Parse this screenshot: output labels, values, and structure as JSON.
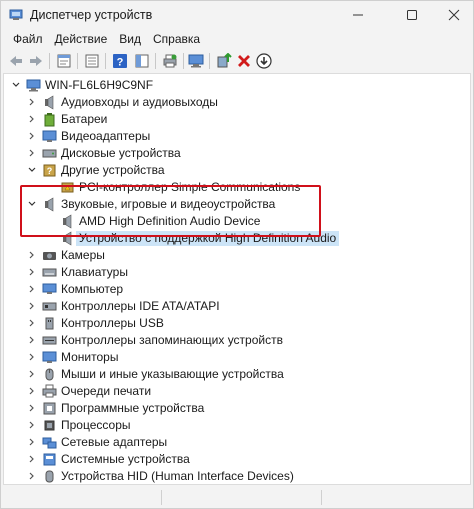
{
  "window": {
    "title": "Диспетчер устройств",
    "icon": "device-manager-icon"
  },
  "menu": [
    {
      "label": "Файл"
    },
    {
      "label": "Действие"
    },
    {
      "label": "Вид"
    },
    {
      "label": "Справка"
    }
  ],
  "toolbar": {
    "buttons": [
      "back-icon",
      "forward-icon",
      "properties-icon",
      "console-icon",
      "help-icon",
      "toggle-pane-icon",
      "print-icon",
      "monitor-scan-icon",
      "update-driver-icon",
      "uninstall-icon",
      "download-icon"
    ]
  },
  "tree": {
    "root": "WIN-FL6L6H9C9NF",
    "items": [
      {
        "label": "Аудиовходы и аудиовыходы",
        "icon": "speaker-icon"
      },
      {
        "label": "Батареи",
        "icon": "battery-icon"
      },
      {
        "label": "Видеоадаптеры",
        "icon": "display-adapter-icon"
      },
      {
        "label": "Дисковые устройства",
        "icon": "disk-drive-icon"
      },
      {
        "label": "Другие устройства",
        "icon": "other-devices-icon"
      },
      {
        "label": "PCI-контроллер Simple Communications",
        "icon": "unknown-device-icon"
      },
      {
        "label": "Звуковые, игровые и видеоустройства",
        "icon": "speaker-icon"
      },
      {
        "label": "AMD High Definition Audio Device",
        "icon": "speaker-icon"
      },
      {
        "label": "Устройство с поддержкой High Definition Audio",
        "icon": "speaker-icon"
      },
      {
        "label": "Камеры",
        "icon": "camera-icon"
      },
      {
        "label": "Клавиатуры",
        "icon": "keyboard-icon"
      },
      {
        "label": "Компьютер",
        "icon": "computer-icon"
      },
      {
        "label": "Контроллеры IDE ATA/ATAPI",
        "icon": "ide-controller-icon"
      },
      {
        "label": "Контроллеры USB",
        "icon": "usb-icon"
      },
      {
        "label": "Контроллеры запоминающих устройств",
        "icon": "storage-controller-icon"
      },
      {
        "label": "Мониторы",
        "icon": "monitor-icon"
      },
      {
        "label": "Мыши и иные указывающие устройства",
        "icon": "mouse-icon"
      },
      {
        "label": "Очереди печати",
        "icon": "printer-icon"
      },
      {
        "label": "Программные устройства",
        "icon": "software-device-icon"
      },
      {
        "label": "Процессоры",
        "icon": "processor-icon"
      },
      {
        "label": "Сетевые адаптеры",
        "icon": "network-adapter-icon"
      },
      {
        "label": "Системные устройства",
        "icon": "system-device-icon"
      },
      {
        "label": "Устройства HID (Human Interface Devices)",
        "icon": "hid-icon"
      }
    ]
  },
  "colors": {
    "highlight_border": "#d0101a",
    "selection": "#cce4f7"
  }
}
